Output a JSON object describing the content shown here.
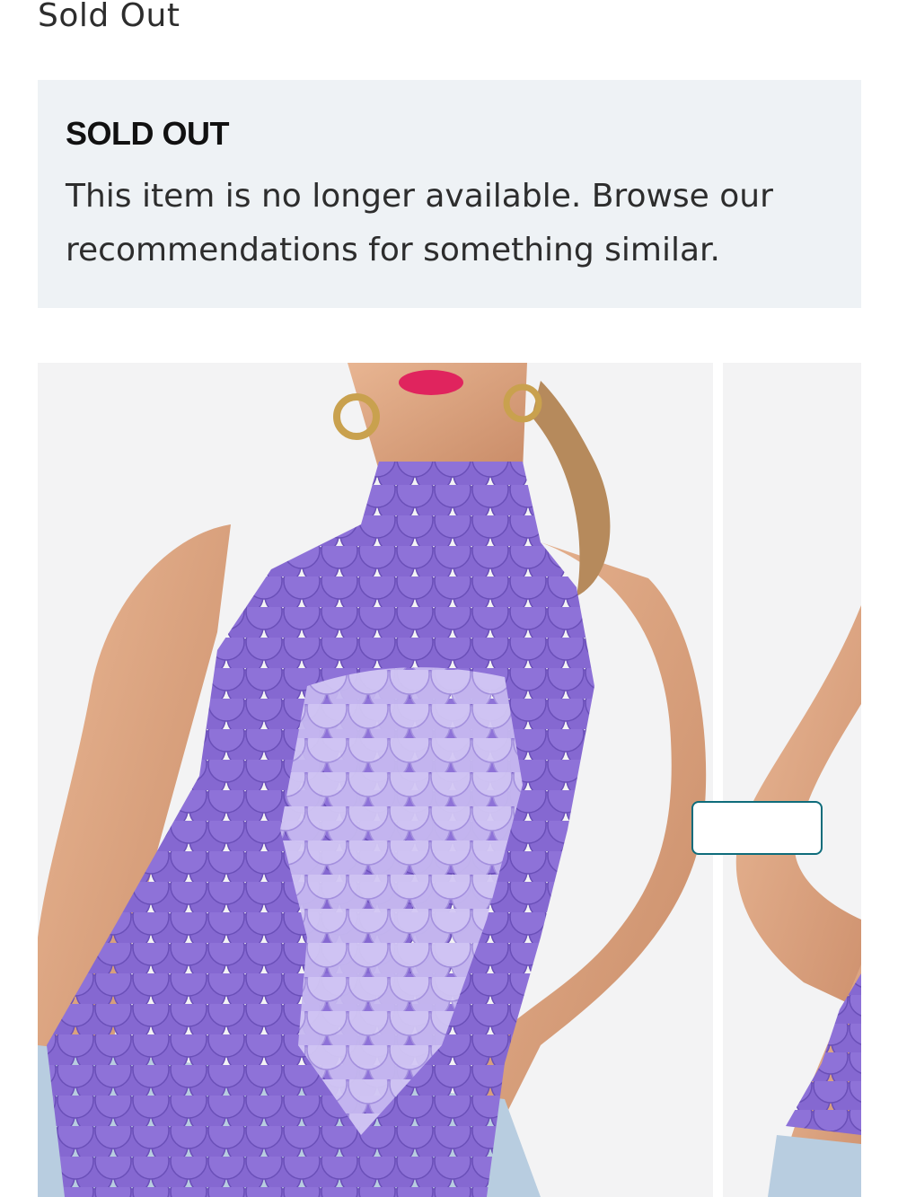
{
  "status": {
    "label": "Sold Out"
  },
  "notice": {
    "title": "SOLD OUT",
    "message": "This item is no longer available. Browse our recommendations for something similar."
  },
  "gallery": {
    "images": [
      {
        "alt": "Model wearing purple sequin halter top, front view"
      },
      {
        "alt": "Model wearing purple sequin halter top, side view"
      }
    ]
  },
  "colors": {
    "notice_background": "#eef2f5",
    "sequin_dark": "#7b5fc7",
    "sequin_light": "#c9bdf0",
    "lipstick": "#e0245e",
    "image_background": "#f3f3f4",
    "accent": "#0e6c7b"
  }
}
